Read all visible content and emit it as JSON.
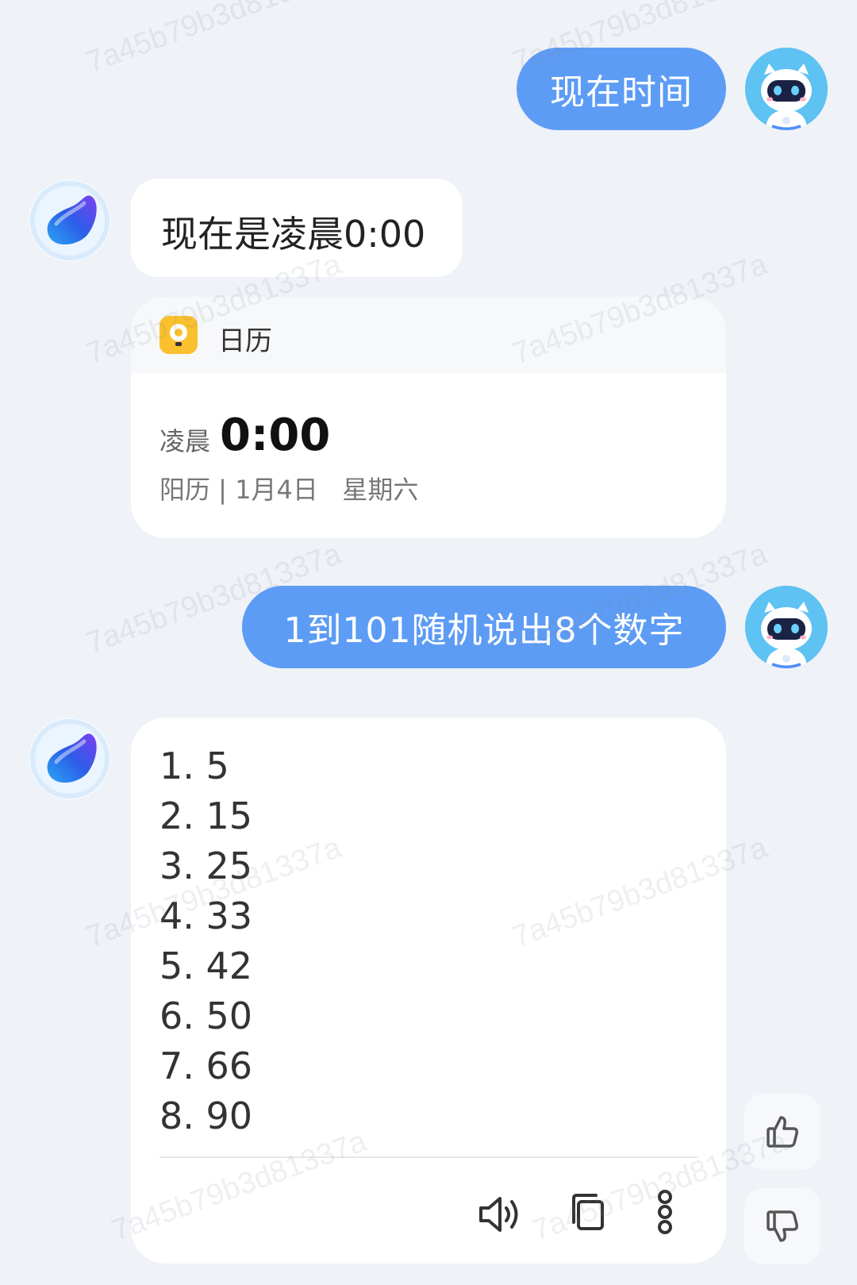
{
  "messages": {
    "user1": "现在时间",
    "ai1": "现在是凌晨0:00",
    "user2": "1到101随机说出8个数字"
  },
  "calendar_card": {
    "app_name": "日历",
    "period": "凌晨",
    "time": "0:00",
    "date_line": "阳历 | 1月4日   星期六"
  },
  "number_list": [
    "1. 5",
    "2. 15",
    "3. 25",
    "4. 33",
    "5. 42",
    "6. 50",
    "7. 66",
    "8. 90"
  ],
  "watermark": "7a45b79b3d81337a",
  "icons": {
    "speaker": "speaker-icon",
    "copy": "copy-icon",
    "more": "more-icon",
    "like": "thumbs-up-icon",
    "dislike": "thumbs-down-icon"
  }
}
